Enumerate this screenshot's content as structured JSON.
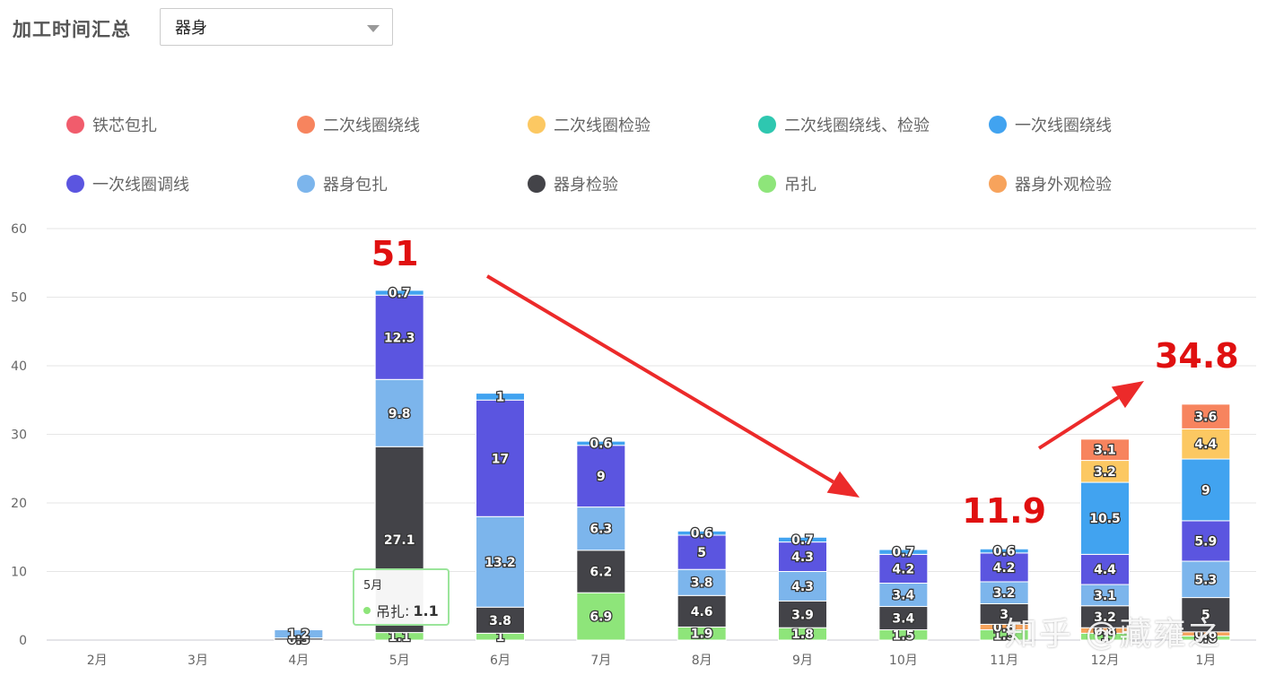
{
  "header": {
    "title": "加工时间汇总"
  },
  "filter": {
    "selected": "器身"
  },
  "chart_data": {
    "type": "bar",
    "stacked": true,
    "categories": [
      "2月",
      "3月",
      "4月",
      "5月",
      "6月",
      "7月",
      "8月",
      "9月",
      "10月",
      "11月",
      "12月",
      "1月"
    ],
    "ylim": [
      0,
      60
    ],
    "yticks": [
      0,
      10,
      20,
      30,
      40,
      50,
      60
    ],
    "grid": true,
    "legend_position": "top",
    "series": [
      {
        "name": "吊扎",
        "color": "#8ee57a",
        "values": [
          0,
          0,
          0,
          1.1,
          1,
          6.9,
          1.9,
          1.8,
          1.5,
          1.5,
          1,
          0.6
        ]
      },
      {
        "name": "器身外观检验",
        "color": "#f7a35c",
        "values": [
          0,
          0,
          0,
          0,
          0,
          0,
          0,
          0,
          0,
          0.8,
          0.8,
          0.6
        ]
      },
      {
        "name": "器身检验",
        "color": "#434348",
        "values": [
          0,
          0,
          0.3,
          27.1,
          3.8,
          6.2,
          4.6,
          3.9,
          3.4,
          3.0,
          3.2,
          5
        ]
      },
      {
        "name": "器身包扎",
        "color": "#7cb5ec",
        "values": [
          0,
          0,
          1.2,
          9.8,
          13.2,
          6.3,
          3.8,
          4.3,
          3.4,
          3.2,
          3.1,
          5.3
        ]
      },
      {
        "name": "一次线圈调线",
        "color": "#5b55e0",
        "values": [
          0,
          0,
          0,
          12.3,
          17,
          9,
          5,
          4.3,
          4.2,
          4.2,
          4.4,
          5.9
        ]
      },
      {
        "name": "一次线圈绕线",
        "color": "#41a3f0",
        "values": [
          0,
          0,
          0,
          0.7,
          1,
          0.6,
          0.6,
          0.7,
          0.7,
          0.6,
          10.5,
          9
        ]
      },
      {
        "name": "二次线圈绕线、检验",
        "color": "#2ec7b0",
        "values": [
          0,
          0,
          0,
          0,
          0,
          0,
          0,
          0,
          0,
          0,
          0,
          0
        ]
      },
      {
        "name": "二次线圈检验",
        "color": "#fcc862",
        "values": [
          0,
          0,
          0,
          0,
          0,
          0,
          0,
          0,
          0,
          0,
          3.2,
          4.4
        ]
      },
      {
        "name": "二次线圈绕线",
        "color": "#f7845e",
        "values": [
          0,
          0,
          0,
          0,
          0,
          0,
          0,
          0,
          0,
          0,
          3.1,
          3.6
        ]
      },
      {
        "name": "铁芯包扎",
        "color": "#f15c6c",
        "values": [
          0,
          0,
          0,
          0,
          0,
          0,
          0,
          0,
          0,
          0,
          0,
          0
        ]
      }
    ],
    "annotations": [
      {
        "text": "51",
        "category": "5月",
        "value": 51
      },
      {
        "text": "11.9",
        "category": "11月",
        "value": 11.9
      },
      {
        "text": "34.8",
        "category": "1月",
        "value": 34.8
      }
    ]
  },
  "legend_order": [
    "铁芯包扎",
    "二次线圈绕线",
    "二次线圈检验",
    "二次线圈绕线、检验",
    "一次线圈绕线",
    "一次线圈调线",
    "器身包扎",
    "器身检验",
    "吊扎",
    "器身外观检验"
  ],
  "tooltip": {
    "title": "5月",
    "series": "吊扎",
    "separator": ":",
    "value": "1.1"
  },
  "watermark": "知乎 @藏雍之"
}
